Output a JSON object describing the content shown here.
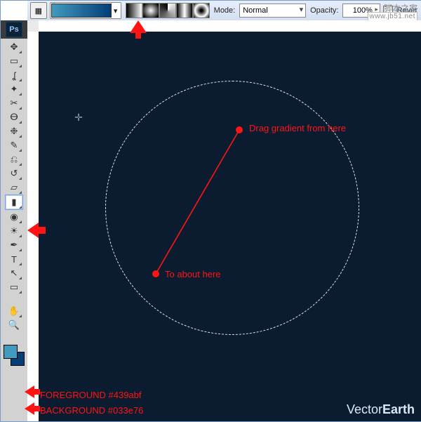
{
  "optionsbar": {
    "mode_label": "Mode:",
    "mode_value": "Normal",
    "opacity_label": "Opacity:",
    "opacity_value": "100%",
    "reverse_label": "Rever"
  },
  "watermark": {
    "line1": "脚本之家",
    "line2": "www.jb51.net"
  },
  "app": {
    "logo": "Ps"
  },
  "colors": {
    "foreground": "#439abf",
    "background": "#033e76"
  },
  "annotations": {
    "drag_from": "Drag gradient from here",
    "to_here": "To about here",
    "fg_label": "FOREGROUND #439abf",
    "bg_label": "BACKGROUND #033e76"
  },
  "brand": {
    "vector": "Vector",
    "earth": "Earth"
  },
  "icons": {
    "move": "✥",
    "marquee": "▭",
    "lasso": "ʆ",
    "wand": "✦",
    "crop": "✂",
    "eyedrop": "ⴱ",
    "heal": "❉",
    "brush": "✎",
    "stamp": "⎌",
    "history": "↺",
    "eraser": "▱",
    "gradient": "▮",
    "blur": "◉",
    "dodge": "☀",
    "pen": "✒",
    "type": "T",
    "path": "↖",
    "shape": "▭",
    "hand": "✋",
    "zoom": "🔍"
  }
}
